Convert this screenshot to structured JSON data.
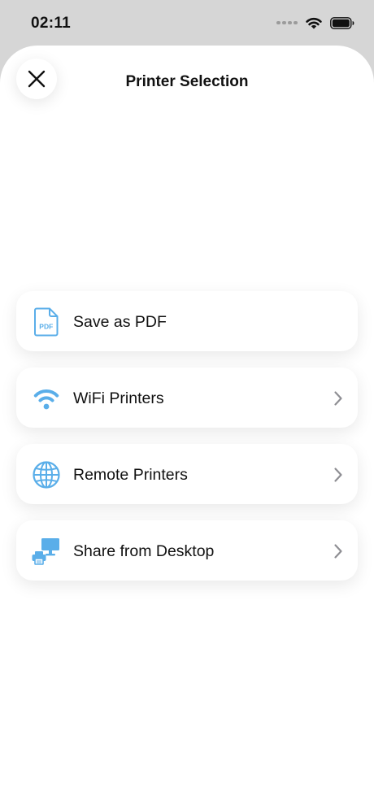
{
  "status_bar": {
    "time": "02:11"
  },
  "sheet": {
    "title": "Printer Selection",
    "close_icon": "close-icon"
  },
  "options": [
    {
      "label": "Save as PDF",
      "icon": "pdf-file-icon",
      "has_chevron": false
    },
    {
      "label": "WiFi Printers",
      "icon": "wifi-icon",
      "has_chevron": true
    },
    {
      "label": "Remote Printers",
      "icon": "globe-icon",
      "has_chevron": true
    },
    {
      "label": "Share from Desktop",
      "icon": "desktop-printer-icon",
      "has_chevron": true
    }
  ],
  "colors": {
    "accent": "#5aaee9",
    "chevron": "#8e8e93",
    "background_dim": "#d6d6d6",
    "sheet": "#ffffff"
  }
}
